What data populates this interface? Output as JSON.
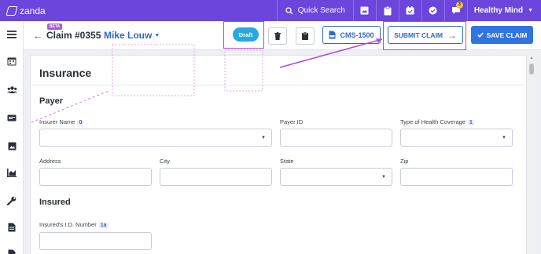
{
  "topbar": {
    "brand": "zanda",
    "search_label": "Quick Search",
    "notification_count": "3",
    "user_name": "Healthy Mind"
  },
  "header": {
    "beta": "BETA",
    "claim_title": "Claim #0355",
    "patient_name": "Mike Louw",
    "status": "Draft",
    "cms_label": "CMS-1500",
    "submit_label": "SUBMIT CLAIM",
    "save_label": "SAVE CLAIM"
  },
  "form": {
    "section_title": "Insurance",
    "payer": {
      "heading": "Payer",
      "insurer_name_label": "Insurer Name",
      "insurer_name_num": "0",
      "payer_id_label": "Payer ID",
      "coverage_label": "Type of Health Coverage",
      "coverage_num": "1",
      "address_label": "Address",
      "city_label": "City",
      "state_label": "State",
      "zip_label": "Zip"
    },
    "insured": {
      "heading": "Insured",
      "id_label": "Insured's I.D. Number",
      "id_num": "1a"
    }
  },
  "icons": {
    "sidebar": [
      "menu-icon",
      "calendar-icon",
      "users-icon",
      "billing-icon",
      "image-icon",
      "chart-icon",
      "wrench-icon",
      "document-icon",
      "file-icon"
    ]
  },
  "colors": {
    "topbar": "#6b45dc",
    "accent": "#2f67c8",
    "draft": "#29a8e0",
    "highlight": "#b04ad6"
  }
}
